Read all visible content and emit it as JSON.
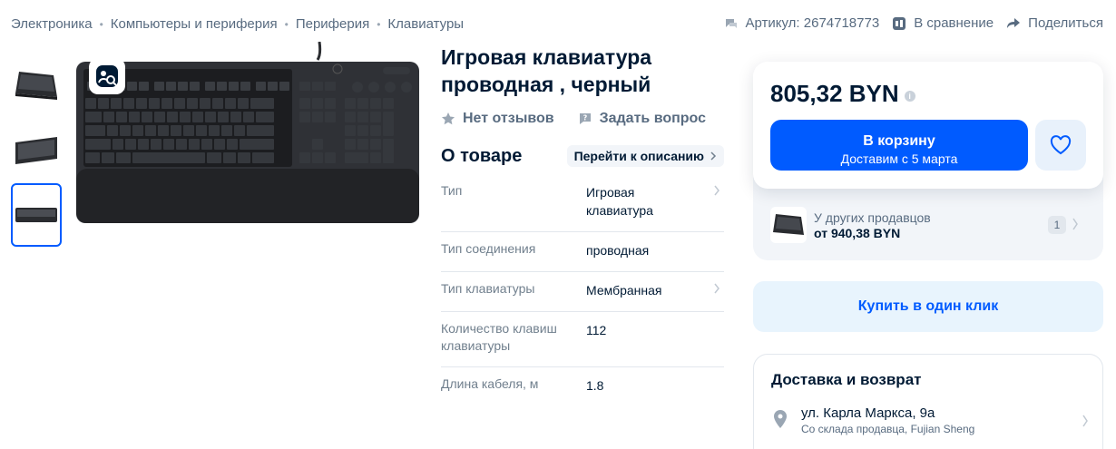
{
  "breadcrumbs": [
    "Электроника",
    "Компьютеры и периферия",
    "Периферия",
    "Клавиатуры"
  ],
  "breadcrumb_separator": "•",
  "top_actions": {
    "article": "Артикул: 2674718773",
    "compare": "В сравнение",
    "share": "Поделиться"
  },
  "product": {
    "title": "Игровая клавиатура проводная , черный",
    "reviews": "Нет отзывов",
    "ask": "Задать вопрос"
  },
  "about": {
    "heading": "О товаре",
    "goto_label": "Перейти к описанию"
  },
  "specs": [
    {
      "key": "Тип",
      "value": "Игровая клавиатура",
      "has_link": true
    },
    {
      "key": "Тип соединения",
      "value": "проводная",
      "has_link": false
    },
    {
      "key": "Тип клавиатуры",
      "value": "Мембранная",
      "has_link": true
    },
    {
      "key": "Количество клавиш клавиатуры",
      "value": "112",
      "has_link": false
    },
    {
      "key": "Длина кабеля, м",
      "value": "1.8",
      "has_link": false
    }
  ],
  "buy": {
    "price": "805,32 BYN",
    "cart_label": "В корзину",
    "cart_sub": "Доставим с 5 марта"
  },
  "other_sellers": {
    "label": "У других продавцов",
    "price": "от 940,38 BYN",
    "count": "1"
  },
  "oneclick_label": "Купить в один клик",
  "delivery": {
    "heading": "Доставка и возврат",
    "address": "ул. Карла Маркса, 9а",
    "source": "Со склада продавца, Fujian Sheng"
  },
  "colors": {
    "accent": "#005bff",
    "text": "#001a34",
    "muted": "#586b80",
    "light_bg": "#f2f5f9"
  },
  "icons": [
    "chat-icon",
    "compare-icon",
    "share-icon",
    "lens-search-icon",
    "star-icon",
    "question-icon",
    "chevron-right-icon",
    "heart-icon",
    "info-icon",
    "location-pin-icon"
  ]
}
